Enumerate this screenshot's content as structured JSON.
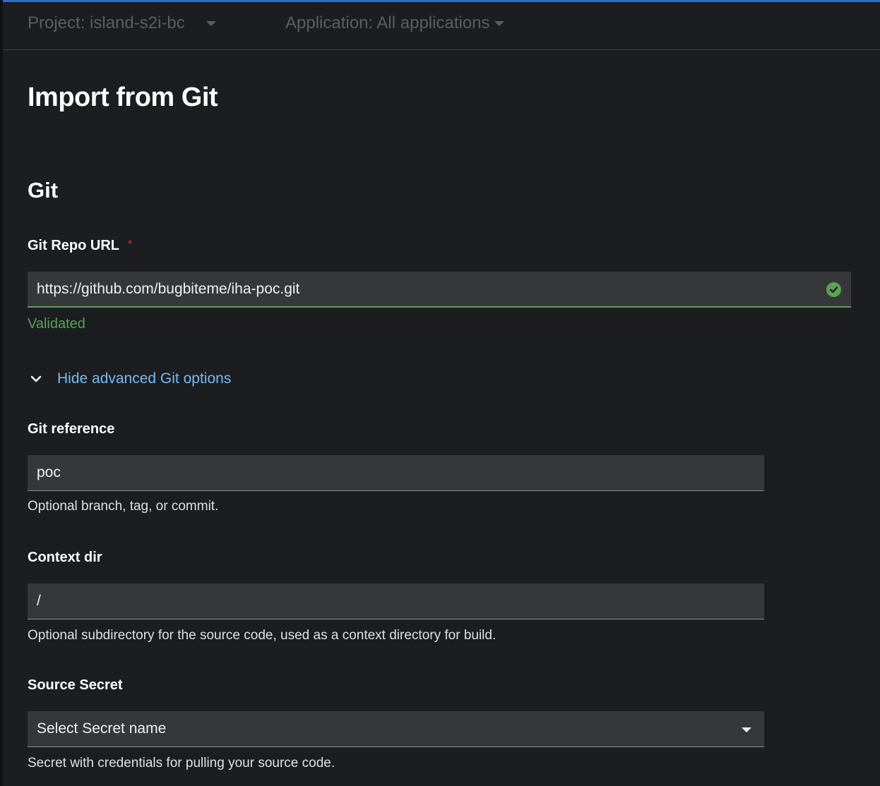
{
  "context_bar": {
    "project_label": "Project: island-s2i-bc",
    "application_label": "Application: All applications"
  },
  "page": {
    "title": "Import from Git",
    "section_title": "Git"
  },
  "git_repo_url": {
    "label": "Git Repo URL",
    "required_marker": "*",
    "value": "https://github.com/bugbiteme/iha-poc.git",
    "status": "Validated",
    "status_icon": "check-circle-icon",
    "status_color": "#5ba352"
  },
  "advanced_toggle": {
    "label": "Hide advanced Git options",
    "icon": "chevron-down-icon",
    "color": "#73bcf7"
  },
  "git_reference": {
    "label": "Git reference",
    "value": "poc",
    "helper": "Optional branch, tag, or commit."
  },
  "context_dir": {
    "label": "Context dir",
    "value": "/",
    "helper": "Optional subdirectory for the source code, used as a context directory for build."
  },
  "source_secret": {
    "label": "Source Secret",
    "selected": "Select Secret name",
    "helper": "Secret with credentials for pulling your source code."
  },
  "colors": {
    "background": "#1b1d21",
    "accent_top": "#2b6cc4",
    "input_background": "#36373a"
  }
}
